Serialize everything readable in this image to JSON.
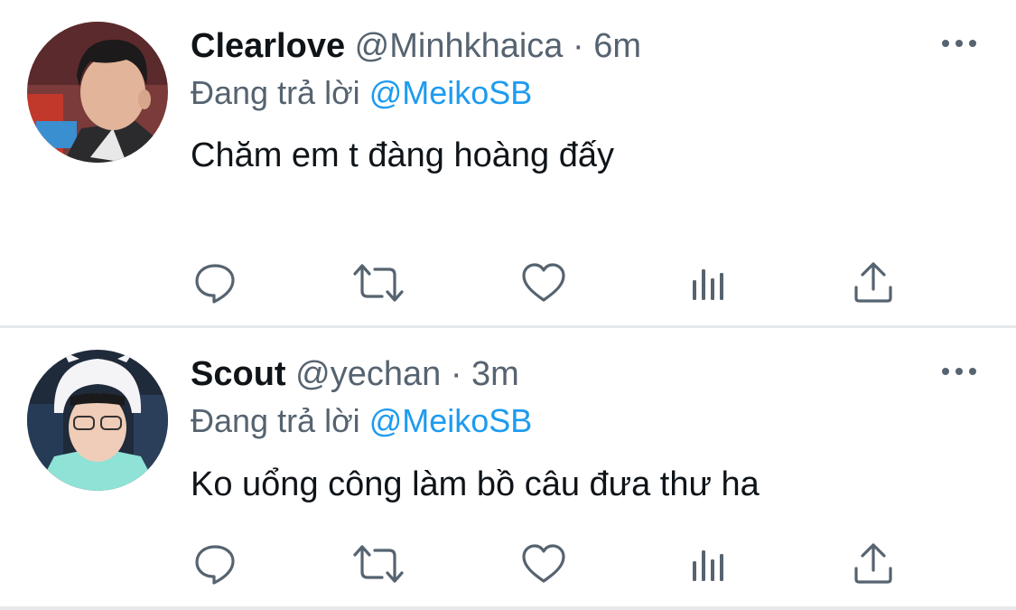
{
  "tweets": [
    {
      "display_name": "Clearlove",
      "handle": "@Minhkhaica",
      "separator": "·",
      "time": "6m",
      "reply_prefix": "Đang trả lời",
      "reply_to": "@MeikoSB",
      "text": "Chăm em t đàng hoàng đấy",
      "avatar_icon": "profile-photo"
    },
    {
      "display_name": "Scout",
      "handle": "@yechan",
      "separator": "·",
      "time": "3m",
      "reply_prefix": "Đang trả lời",
      "reply_to": "@MeikoSB",
      "text": "Ko uổng công làm bồ câu đưa thư ha",
      "avatar_icon": "profile-photo"
    }
  ],
  "action_icons": [
    "reply-icon",
    "retweet-icon",
    "like-icon",
    "analytics-icon",
    "share-icon"
  ],
  "colors": {
    "text_primary": "#0f1419",
    "text_secondary": "#566370",
    "mention": "#1d9bf0",
    "divider": "#e6e9eb"
  }
}
